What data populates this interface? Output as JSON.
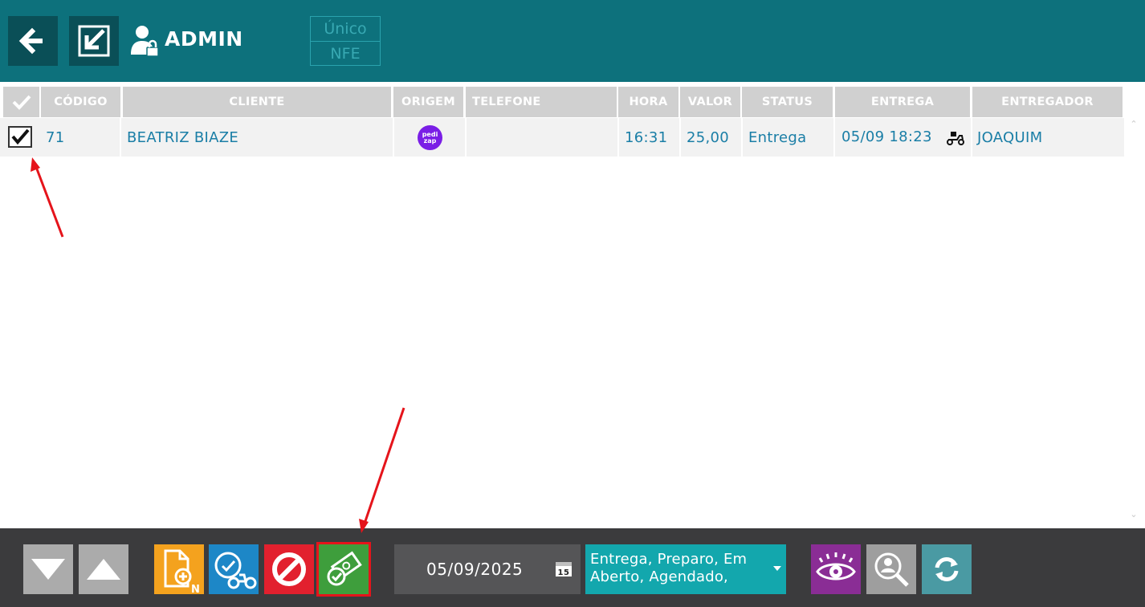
{
  "header": {
    "user_label": "ADMIN",
    "mode_options": [
      "Único",
      "NFE"
    ]
  },
  "table": {
    "columns": [
      "",
      "CÓDIGO",
      "CLIENTE",
      "ORIGEM",
      "TELEFONE",
      "HORA",
      "VALOR",
      "STATUS",
      "ENTREGA",
      "ENTREGADOR"
    ],
    "rows": [
      {
        "checked": true,
        "codigo": "71",
        "cliente": "BEATRIZ BIAZE",
        "origem_badge": "pedi zap",
        "telefone": "",
        "hora": "16:31",
        "valor": "25,00",
        "status": "Entrega",
        "entrega": "05/09 18:23",
        "entregador": "JOAQUIM"
      }
    ]
  },
  "toolbar": {
    "date_value": "05/09/2025",
    "calendar_day": "15",
    "status_filter": "Entrega, Preparo, Em Aberto, Agendado,",
    "new_order_badge": "N"
  },
  "colors": {
    "header_bg": "#0d717c",
    "footer_bg": "#3b3b3d",
    "text_blue": "#1a7ea6",
    "highlight_red": "#e5141b"
  }
}
